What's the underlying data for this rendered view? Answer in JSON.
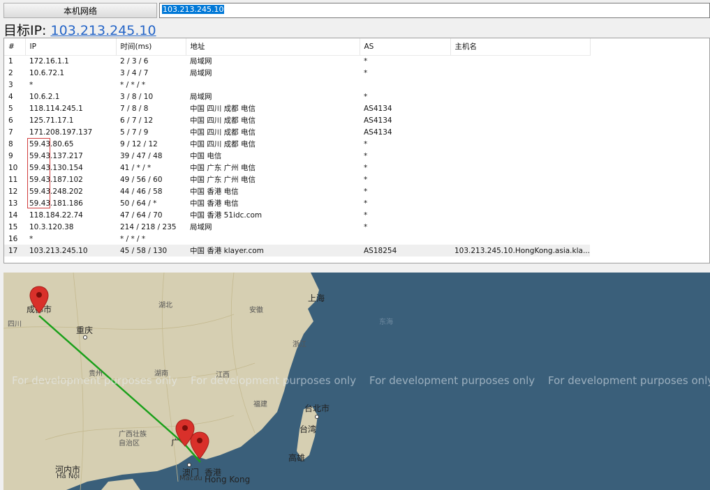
{
  "toolbar": {
    "source_button": "本机网络",
    "target_value": "103.213.245.10"
  },
  "headline": {
    "prefix": "目标IP: ",
    "ip": "103.213.245.10"
  },
  "table": {
    "headers": [
      "#",
      "IP",
      "时间(ms)",
      "地址",
      "AS",
      "主机名"
    ],
    "rows": [
      [
        "1",
        "172.16.1.1",
        "2 / 3 / 6",
        "局域网",
        "*",
        ""
      ],
      [
        "2",
        "10.6.72.1",
        "3 / 4 / 7",
        "局域网",
        "*",
        ""
      ],
      [
        "3",
        "*",
        "* / * / *",
        "",
        "",
        ""
      ],
      [
        "4",
        "10.6.2.1",
        "3 / 8 / 10",
        "局域网",
        "*",
        ""
      ],
      [
        "5",
        "118.114.245.1",
        "7 / 8 / 8",
        "中国 四川 成都 电信",
        "AS4134",
        ""
      ],
      [
        "6",
        "125.71.17.1",
        "6 / 7 / 12",
        "中国 四川 成都 电信",
        "AS4134",
        ""
      ],
      [
        "7",
        "171.208.197.137",
        "5 / 7 / 9",
        "中国 四川 成都 电信",
        "AS4134",
        ""
      ],
      [
        "8",
        "59.43.80.65",
        "9 / 12 / 12",
        "中国 四川 成都 电信",
        "*",
        ""
      ],
      [
        "9",
        "59.43.137.217",
        "39 / 47 / 48",
        "中国 电信",
        "*",
        ""
      ],
      [
        "10",
        "59.43.130.154",
        "41 / * / *",
        "中国 广东 广州 电信",
        "*",
        ""
      ],
      [
        "11",
        "59.43.187.102",
        "49 / 56 / 60",
        "中国 广东 广州 电信",
        "*",
        ""
      ],
      [
        "12",
        "59.43.248.202",
        "44 / 46 / 58",
        "中国 香港 电信",
        "*",
        ""
      ],
      [
        "13",
        "59.43.181.186",
        "50 / 64 / *",
        "中国 香港 电信",
        "*",
        ""
      ],
      [
        "14",
        "118.184.22.74",
        "47 / 64 / 70",
        "中国 香港 51idc.com",
        "*",
        ""
      ],
      [
        "15",
        "10.3.120.38",
        "214 / 218 / 235",
        "局域网",
        "*",
        ""
      ],
      [
        "16",
        "*",
        "* / * / *",
        "",
        "",
        ""
      ],
      [
        "17",
        "103.213.245.10",
        "45 / 58 / 130",
        "中国 香港 klayer.com",
        "AS18254",
        "103.213.245.10.HongKong.asia.kla..."
      ]
    ],
    "selected_row": 17
  },
  "map": {
    "watermark": "For development purposes only",
    "labels": {
      "chengdu": "成都市",
      "sichuan": "四川",
      "chongqing": "重庆",
      "hubei": "湖北",
      "anhui": "安徽",
      "shanghai": "上海",
      "donghai": "东海",
      "zhejiang": "浙江",
      "guizhou": "贵州",
      "hunan": "湖南",
      "jiangxi": "江西",
      "fujian": "福建",
      "taibei": "台北市",
      "taiwan": "台湾",
      "gaoxiong": "高雄",
      "guangxi": "广西壮族自治区",
      "hanoi_cn": "河内市",
      "hanoi": "Hà Nội",
      "aomen": "澳门",
      "macau": "Macau",
      "xianggang": "香港",
      "hongkong": "Hong Kong",
      "guang": "广"
    },
    "route_color": "#1aa01a",
    "pin_color": "#d9302a"
  }
}
